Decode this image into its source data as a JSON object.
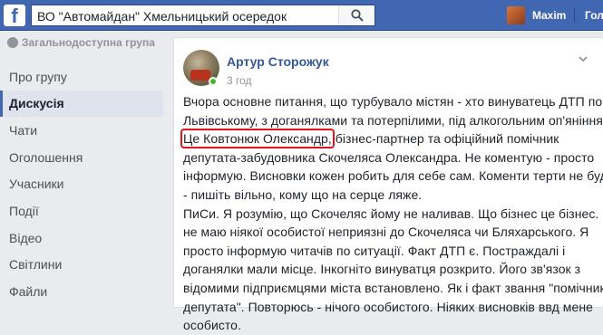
{
  "topbar": {
    "search_value": "ВО \"Автомайдан\" Хмельницький осередок",
    "user_name": "Maxim",
    "home_label": "Голо"
  },
  "sidebar": {
    "group_type": "Загальнодоступна група",
    "items": [
      {
        "label": "Про групу"
      },
      {
        "label": "Дискусія"
      },
      {
        "label": "Чати"
      },
      {
        "label": "Оголошення"
      },
      {
        "label": "Учасники"
      },
      {
        "label": "Події"
      },
      {
        "label": "Відео"
      },
      {
        "label": "Світлини"
      },
      {
        "label": "Файли"
      }
    ],
    "active_index": 1
  },
  "post": {
    "author": "Артур Сторожук",
    "time": "3 год",
    "lines": [
      "Вчора основне питання, що турбувало містян - хто винуватець ДТП по",
      "Львівському, з доганялками та потерпілими, під алкогольним оп'янінням.",
      "бізнес-партнер та офіційний помічник",
      "депутата-забудовника Скочеляса Олександра. Не коментую - просто",
      "інформую. Висновки кожен робить для себе сам. Коменти терти не буду",
      "- пишіть вільно, кому що на серце ляже.",
      "ПиСи. Я розумію, що Скочеляс йому не наливав. Що бізнес це бізнес. Я",
      "не маю ніякої особистої неприязні до Скочеляса чи Бляхарського. Я",
      "просто інформую читачів по ситуації. Факт ДТП є. Постраждалі і",
      "доганялки мали місце. Інкогніто винуватця розкрито. Його зв'язок з",
      "відомими підприємцями міста встановлено. Як і факт звання \"помічник",
      "депутата\". Повторюсь - нічого особистого. Ніяких висновків ввд мене",
      "особисто."
    ],
    "highlighted_text": "Це Ковтонюк Олександр,"
  },
  "colors": {
    "topbar": "#4267b2",
    "link": "#365899",
    "highlight_border": "#e0141e",
    "online": "#42b72a"
  },
  "icons": [
    "facebook-logo-icon",
    "search-icon",
    "globe-icon",
    "more-options-icon"
  ]
}
